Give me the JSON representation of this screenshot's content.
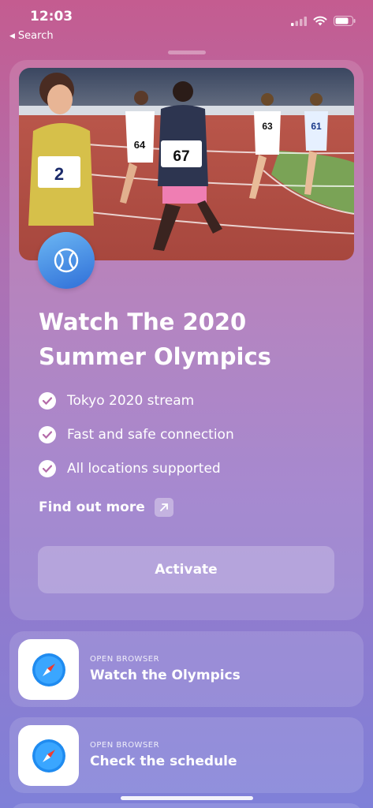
{
  "status_bar": {
    "time": "12:03",
    "back_label": "Search"
  },
  "card": {
    "title_line1": "Watch The 2020",
    "title_line2": "Summer Olympics",
    "features": [
      "Tokyo 2020 stream",
      "Fast and safe connection",
      "All locations supported"
    ],
    "find_out_more": "Find out more",
    "activate_label": "Activate",
    "runner_bibs": [
      "2",
      "64",
      "67",
      "63",
      "61"
    ]
  },
  "shortcuts": [
    {
      "kicker": "OPEN BROWSER",
      "label": "Watch the Olympics",
      "icon": "safari-icon"
    },
    {
      "kicker": "OPEN BROWSER",
      "label": "Check the schedule",
      "icon": "safari-icon"
    }
  ]
}
